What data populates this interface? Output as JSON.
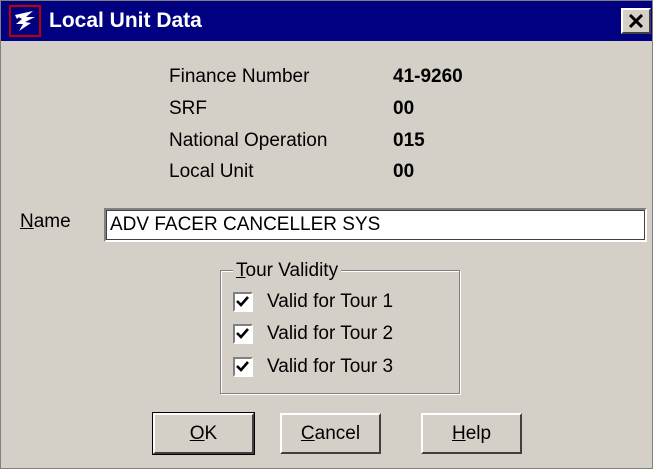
{
  "window": {
    "title": "Local Unit Data",
    "icon": "eagle-logo-icon",
    "close": "close-icon"
  },
  "info": [
    {
      "label": "Finance Number",
      "value": "41-9260"
    },
    {
      "label": "SRF",
      "value": "00"
    },
    {
      "label": "National Operation",
      "value": "015"
    },
    {
      "label": "Local Unit",
      "value": "00"
    }
  ],
  "name_field": {
    "label_mnemonic": "N",
    "label_rest": "ame",
    "value": "ADV FACER CANCELLER SYS"
  },
  "tour_validity": {
    "legend_mnemonic": "T",
    "legend_rest": "our Validity",
    "tours": [
      {
        "label": "Valid for Tour 1",
        "checked": true
      },
      {
        "label": "Valid for Tour 2",
        "checked": true
      },
      {
        "label": "Valid for Tour 3",
        "checked": true
      }
    ]
  },
  "buttons": {
    "ok": {
      "mnemonic": "O",
      "rest": "K"
    },
    "cancel": {
      "mnemonic": "C",
      "rest": "ancel"
    },
    "help": {
      "mnemonic": "H",
      "rest": "elp"
    }
  }
}
